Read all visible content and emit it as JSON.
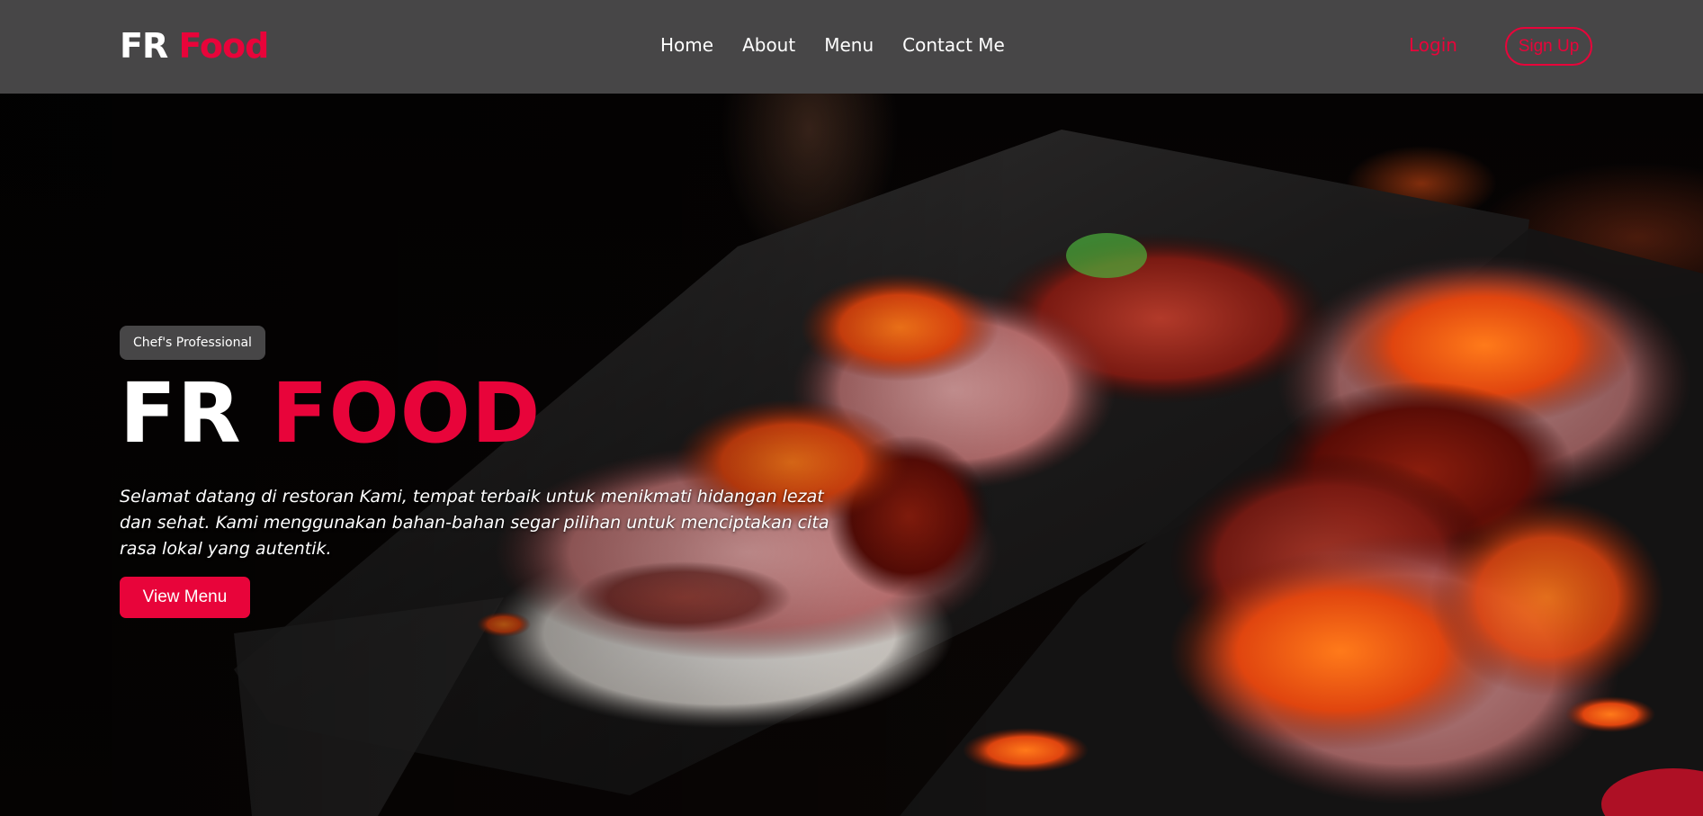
{
  "header": {
    "logo_part1": "FR",
    "logo_part2": "Food",
    "nav": [
      {
        "label": "Home"
      },
      {
        "label": "About"
      },
      {
        "label": "Menu"
      },
      {
        "label": "Contact Me"
      }
    ],
    "login_label": "Login",
    "signup_label": "Sign Up"
  },
  "hero": {
    "badge": "Chef's Professional",
    "title_part1": "FR",
    "title_part2": "FOOD",
    "description": "Selamat datang di restoran Kami, tempat terbaik untuk menikmati hidangan lezat dan sehat. Kami menggunakan bahan-bahan segar pilihan untuk menciptakan cita rasa lokal yang autentik.",
    "cta_label": "View Menu"
  },
  "colors": {
    "accent": "#e8043a",
    "navbar_bg": "#474647",
    "badge_bg": "#474647",
    "text": "#ffffff"
  }
}
